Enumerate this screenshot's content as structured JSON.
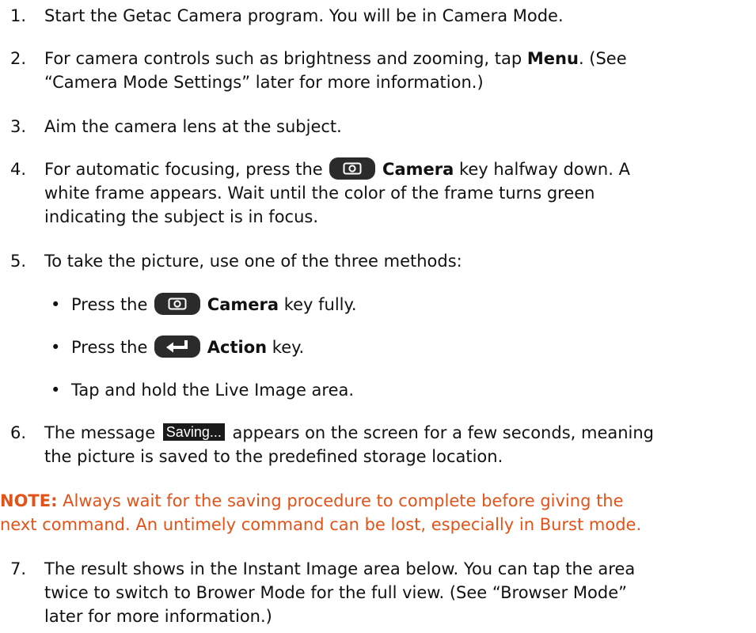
{
  "steps": [
    {
      "num": "1.",
      "text": "Start the Getac Camera program. You will be in Camera Mode."
    },
    {
      "num": "2.",
      "pre": "For camera controls such as brightness and zooming, tap ",
      "bold": "Menu",
      "post": ". (See",
      "line2": "“Camera Mode Settings” later for more information.)"
    },
    {
      "num": "3.",
      "text": "Aim the camera lens at the subject."
    },
    {
      "num": "4.",
      "pre": "For automatic focusing, press the ",
      "bold": "Camera",
      "post": " key halfway down. A",
      "line2": "white frame appears. Wait until the color of the frame turns green",
      "line3": "indicating the subject is in focus."
    },
    {
      "num": "5.",
      "text": "To take the picture, use one of the three methods:"
    },
    {
      "num": "6.",
      "pre": "The message ",
      "badge": "Saving...",
      "post": " appears on the screen for a few seconds, meaning",
      "line2": "the picture is saved to the predefined storage location."
    },
    {
      "num": "7.",
      "text": "The result shows in the Instant Image area below. You can tap the area",
      "line2": "twice to switch to Brower Mode for the full view. (See “Browser Mode”",
      "line3": "later for more information.)"
    }
  ],
  "bullets": [
    {
      "dot": "•",
      "pre": "Press the ",
      "icon": "camera-key-icon",
      "bold": "Camera",
      "post": " key fully."
    },
    {
      "dot": "•",
      "pre": "Press the ",
      "icon": "action-key-icon",
      "bold": "Action",
      "post": " key."
    },
    {
      "dot": "•",
      "text": "Tap and hold the Live Image area."
    }
  ],
  "note": {
    "label": "NOTE:",
    "line1": " Always wait for the saving procedure to complete before giving the",
    "line2": "next command. An untimely command can be lost, especially in Burst mode."
  },
  "colors": {
    "note": "#e2531a",
    "text": "#111111",
    "key": "#2b2b2b"
  }
}
